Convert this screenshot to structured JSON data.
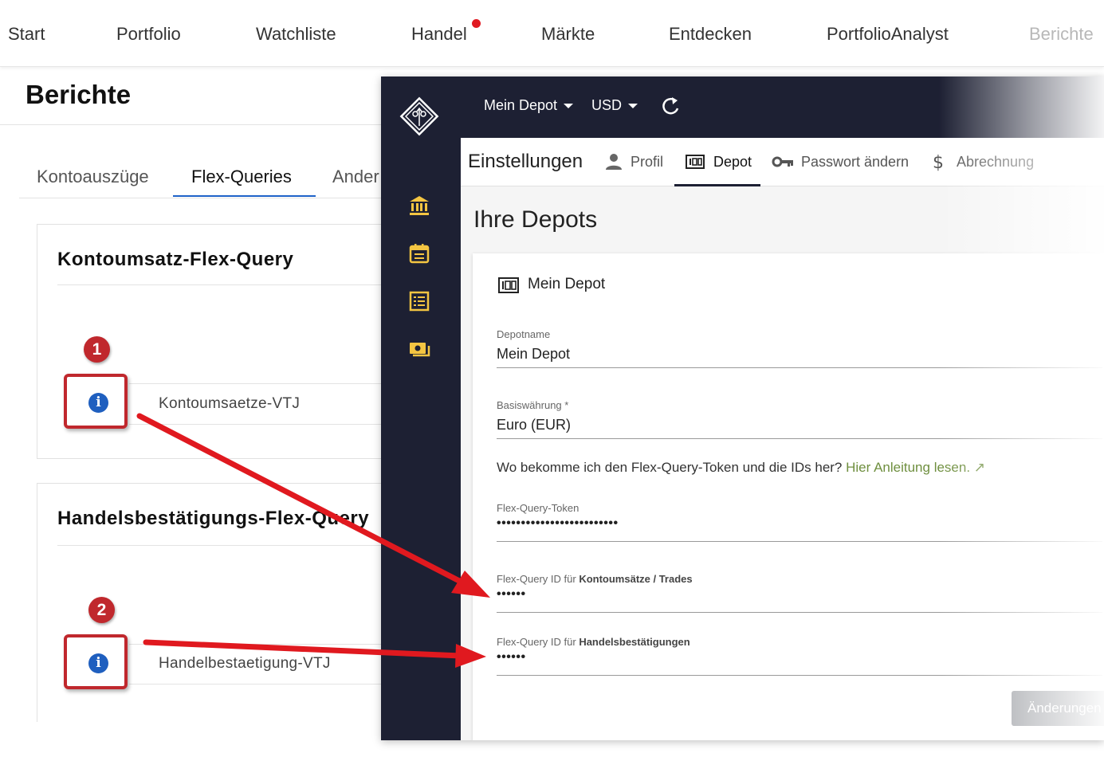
{
  "topnav": {
    "items": [
      "Start",
      "Portfolio",
      "Watchliste",
      "Handel",
      "Märkte",
      "Entdecken",
      "PortfolioAnalyst",
      "Berichte"
    ]
  },
  "reports": {
    "title": "Berichte",
    "tabs": [
      "Kontoauszüge",
      "Flex-Queries",
      "Ander"
    ],
    "active_tab": "Flex-Queries",
    "cards": [
      {
        "title": "Kontoumsatz-Flex-Query",
        "row_label": "Kontoumsaetze-VTJ",
        "badge": "1"
      },
      {
        "title": "Handelsbestätigungs-Flex-Query",
        "row_label": "Handelbestaetigung-VTJ",
        "badge": "2"
      }
    ]
  },
  "overlay": {
    "header": {
      "depot_select": "Mein Depot",
      "currency_select": "USD"
    },
    "sidebar_icons": [
      "bank-icon",
      "calendar-icon",
      "list-icon",
      "cash-icon"
    ],
    "settings": {
      "title": "Einstellungen",
      "tabs": [
        "Profil",
        "Depot",
        "Passwort ändern",
        "Abrechnung"
      ],
      "active_tab": "Depot"
    },
    "section_title": "Ihre Depots",
    "depot_card": {
      "title": "Mein Depot",
      "depotname_label": "Depotname",
      "depotname_value": "Mein Depot",
      "currency_label": "Basiswährung *",
      "currency_value": "Euro (EUR)",
      "help_text": "Wo bekomme ich den Flex-Query-Token und die IDs her?",
      "help_link": "Hier Anleitung lesen. ↗",
      "token_label": "Flex-Query-Token",
      "token_value": "•••••••••••••••••••••••••",
      "id_trades_label_prefix": "Flex-Query ID für",
      "id_trades_label_bold": "Kontoumsätze / Trades",
      "id_trades_value": "••••••",
      "id_confirm_label_prefix": "Flex-Query ID für",
      "id_confirm_label_bold": "Handelsbestätigungen",
      "id_confirm_value": "••••••",
      "save_button": "Änderungen"
    }
  },
  "colors": {
    "annotation_red": "#c0282d",
    "arrow_red": "#e0191f",
    "dark_navy": "#1d2033",
    "info_blue": "#1f5fbf",
    "link_green": "#6f8f3f"
  }
}
